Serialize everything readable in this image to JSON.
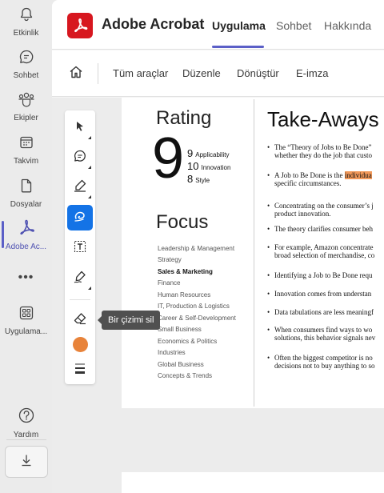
{
  "rail": {
    "items": [
      {
        "label": "Etkinlik",
        "icon": "bell-icon"
      },
      {
        "label": "Sohbet",
        "icon": "chat-icon"
      },
      {
        "label": "Ekipler",
        "icon": "teams-icon"
      },
      {
        "label": "Takvim",
        "icon": "calendar-icon"
      },
      {
        "label": "Dosyalar",
        "icon": "file-icon"
      },
      {
        "label": "Adobe Ac...",
        "icon": "acrobat-icon"
      },
      {
        "label": "Uygulama...",
        "icon": "apps-icon"
      },
      {
        "label": "Yardım",
        "icon": "help-icon"
      }
    ],
    "more": "•••"
  },
  "header": {
    "title": "Adobe Acrobat",
    "tabs": [
      {
        "label": "Uygulama",
        "active": true
      },
      {
        "label": "Sohbet"
      },
      {
        "label": "Hakkında"
      }
    ]
  },
  "toolbar": {
    "items": [
      "Tüm araçlar",
      "Düzenle",
      "Dönüştür",
      "E-imza"
    ]
  },
  "tools": {
    "tooltip": "Bir çizimi sil",
    "active_color": "#e8833a",
    "accent": "#1473e6"
  },
  "document": {
    "rating_title": "Rating",
    "big_score": "9",
    "scores": [
      {
        "value": "9",
        "name": "Applicability"
      },
      {
        "value": "10",
        "name": "Innovation"
      },
      {
        "value": "8",
        "name": "Style"
      }
    ],
    "focus_title": "Focus",
    "focus_items": [
      "Leadership & Management",
      "Strategy",
      "Sales & Marketing",
      "Finance",
      "Human Resources",
      "IT, Production & Logistics",
      "Career & Self-Development",
      "Small Business",
      "Economics & Politics",
      "Industries",
      "Global Business",
      "Concepts & Trends"
    ],
    "focus_bold_index": 2,
    "takeaways_title": "Take-Aways",
    "takeaways": [
      {
        "l1": "The “Theory of Jobs to Be Done”",
        "l2": "whether they do the job that custo"
      },
      {
        "l1a": "A Job to Be Done is the ",
        "l1hl": "individua",
        "l2": "specific circumstances."
      },
      {
        "l1": "Concentrating on the consumer’s j",
        "l2": "product innovation."
      },
      {
        "l1": "The theory clarifies consumer beh"
      },
      {
        "l1": "For example, Amazon concentrate",
        "l2": "broad selection of merchandise, co"
      },
      {
        "l1": "Identifying a Job to Be Done requ"
      },
      {
        "l1": "Innovation comes from understan"
      },
      {
        "l1": "Data tabulations are less meaningf"
      },
      {
        "l1": "When consumers find ways to wo",
        "l2": "solutions, this behavior signals nev"
      },
      {
        "l1": "Often the biggest competitor is no",
        "l2": "decisions not to buy anything to so"
      }
    ]
  }
}
